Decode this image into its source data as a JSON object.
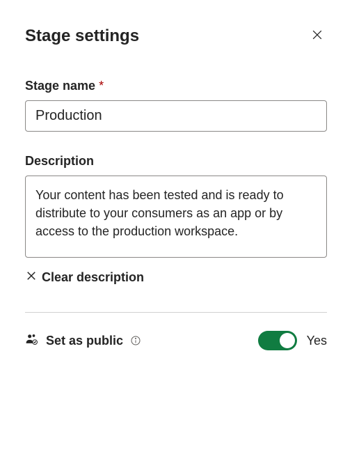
{
  "header": {
    "title": "Stage settings"
  },
  "stageName": {
    "label": "Stage name",
    "requiredMark": "*",
    "value": "Production"
  },
  "description": {
    "label": "Description",
    "value": "Your content has been tested and is ready to distribute to your consumers as an app or by access to the production workspace.",
    "clearLabel": "Clear description"
  },
  "public": {
    "label": "Set as public",
    "toggleState": "on",
    "toggleText": "Yes"
  },
  "colors": {
    "toggleOn": "#107c41"
  }
}
